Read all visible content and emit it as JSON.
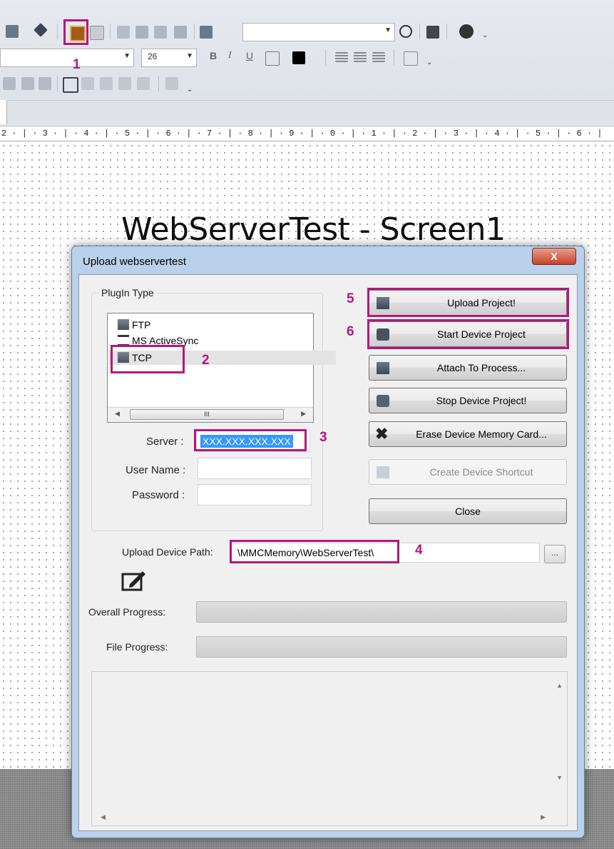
{
  "toolbar": {
    "font_size": "26",
    "overflow_glyph": "⌄"
  },
  "ruler": {
    "text": "2 · | · 3 · | · 4 · | · 5 · | · 6 · | · 7 · | · 8 · | · 9 · | · 0 · | · 1 · | · 2 · | · 3 · | · 4 · | · 5 · | · 6 · |"
  },
  "canvas": {
    "screen_title": "WebServerTest - Screen1"
  },
  "dialog": {
    "title": "Upload webservertest",
    "close_glyph": "X",
    "plugin_group_label": "PlugIn Type",
    "plugins": [
      {
        "label": "FTP",
        "icon": "ftp-icon"
      },
      {
        "label": "MS ActiveSync",
        "icon": "sync-icon"
      },
      {
        "label": "TCP",
        "icon": "tcp-icon",
        "selected": true
      }
    ],
    "scroll_thumb_glyph": "III",
    "server_label": "Server :",
    "server_value": "XXX.XXX.XXX.XXX",
    "username_label": "User Name :",
    "username_value": "",
    "password_label": "Password :",
    "password_value": "",
    "buttons": {
      "upload": "Upload Project!",
      "start": "Start Device Project",
      "attach": "Attach To Process...",
      "stop": "Stop Device Project!",
      "erase": "Erase Device Memory Card...",
      "shortcut": "Create Device Shortcut",
      "close": "Close"
    },
    "path_label": "Upload Device Path:",
    "path_value": "\\MMCMemory\\WebServerTest\\",
    "browse_label": "...",
    "overall_progress_label": "Overall Progress:",
    "overall_progress": 0,
    "file_progress_label": "File Progress:",
    "file_progress": 0
  },
  "annotations": [
    "1",
    "2",
    "3",
    "4",
    "5",
    "6"
  ],
  "colors": {
    "highlight": "#b5177c",
    "selection": "#3399ff"
  }
}
